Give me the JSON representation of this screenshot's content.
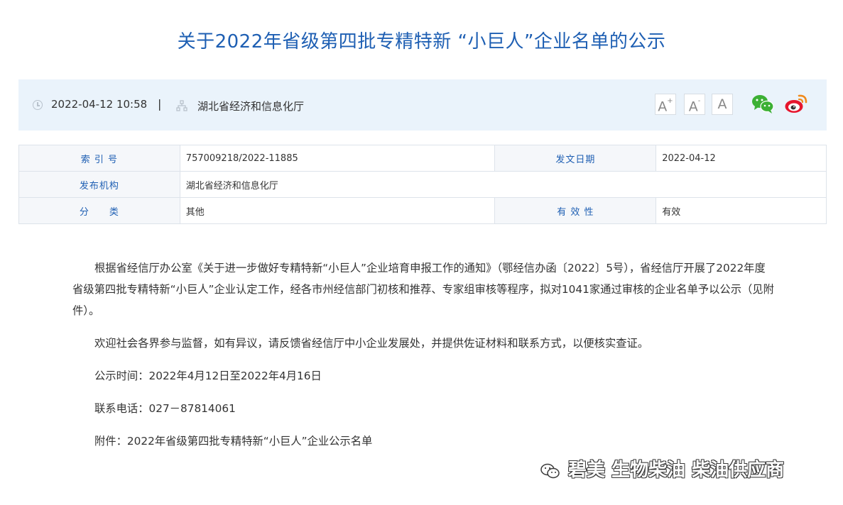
{
  "article": {
    "title": "关于2022年省级第四批专精特新 “小巨人”企业名单的公示"
  },
  "meta": {
    "date": "2022-04-12 10:58",
    "separator": "|",
    "organization": "湖北省经济和信息化厅",
    "font_buttons": {
      "large": "A",
      "large_mark": "+",
      "medium": "A",
      "medium_mark": "-",
      "default": "A"
    },
    "share": {
      "wechat_icon": "wechat-icon",
      "weibo_icon": "weibo-icon",
      "wechat_color": "#3cb034",
      "weibo_color": "#f08a1c"
    }
  },
  "info_table": {
    "index_label": "索 引 号",
    "index_value": "757009218/2022-11885",
    "date_label": "发文日期",
    "date_value": "2022-04-12",
    "publisher_label": "发布机构",
    "publisher_value": "湖北省经济和信息化厅",
    "category_label": "分　　类",
    "category_value": "其他",
    "validity_label": "有 效 性",
    "validity_value": "有效"
  },
  "body": {
    "p1": "根据省经信厅办公室《关于进一步做好专精特新“小巨人”企业培育申报工作的通知》（鄂经信办函〔2022〕5号），省经信厅开展了2022年度省级第四批专精特新“小巨人”企业认定工作，经各市州经信部门初核和推荐、专家组审核等程序，拟对1041家通过审核的企业名单予以公示（见附件）。",
    "p2": "欢迎社会各界参与监督，如有异议，请反馈省经信厅中小企业发展处，并提供佐证材料和联系方式，以便核实查证。",
    "p3": "公示时间：2022年4月12日至2022年4月16日",
    "p4": "联系电话：027－87814061",
    "p5": "附件：2022年省级第四批专精特新“小巨人”企业公示名单"
  },
  "watermark": {
    "text": "碧美 生物柴油 柴油供应商"
  },
  "colors": {
    "title": "#1e5fb3",
    "meta_background": "#eaf3fb",
    "table_label": "#1e5fb3"
  }
}
